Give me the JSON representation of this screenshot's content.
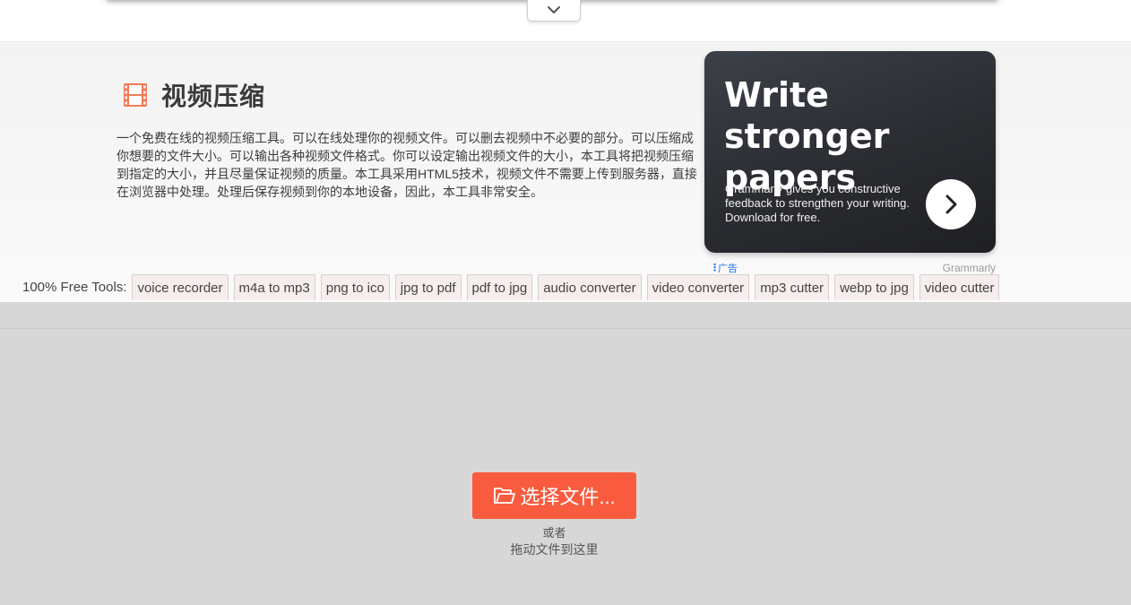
{
  "header": {
    "expand_icon": "chevron-down-icon"
  },
  "tool": {
    "icon": "film-icon",
    "icon_color": "#f07a5a",
    "title": "视频压缩",
    "description": "一个免费在线的视频压缩工具。可以在线处理你的视频文件。可以删去视频中不必要的部分。可以压缩成你想要的文件大小。可以输出各种视频文件格式。你可以设定输出视频文件的大小，本工具将把视频压缩到指定的大小，并且尽量保证视频的质量。本工具采用HTML5技术，视频文件不需要上传到服务器，直接在浏览器中处理。处理后保存视频到你的本地设备，因此，本工具非常安全。"
  },
  "ad": {
    "headline": "Write stronger papers",
    "body": "Grammarly gives you constructive feedback to strengthen your writing. Download for free.",
    "label": "广告",
    "brand": "Grammarly",
    "arrow_icon": "chevron-right-icon"
  },
  "tools_bar": {
    "lead": "100% Free Tools:",
    "items": [
      {
        "label": "voice recorder"
      },
      {
        "label": "m4a to mp3"
      },
      {
        "label": "png to ico"
      },
      {
        "label": "jpg to pdf"
      },
      {
        "label": "pdf to jpg"
      },
      {
        "label": "audio converter"
      },
      {
        "label": "video converter"
      },
      {
        "label": "mp3 cutter"
      },
      {
        "label": "webp to jpg"
      },
      {
        "label": "video cutter"
      }
    ]
  },
  "upload": {
    "button_label": "选择文件...",
    "button_icon": "folder-open-icon",
    "button_color": "#f95b3e",
    "or_text": "或者",
    "drag_text": "拖动文件到这里"
  }
}
